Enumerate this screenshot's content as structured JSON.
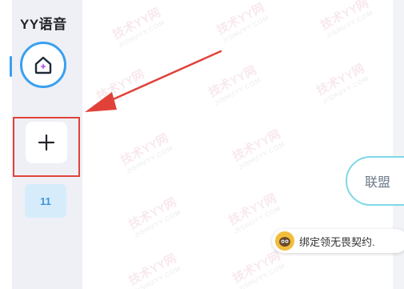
{
  "app": {
    "title": "YY语音"
  },
  "sidebar": {
    "home_icon": "home-sparkle-icon",
    "add_icon": "plus-icon",
    "count_badge": "11"
  },
  "channel": {
    "alliance_label": "联盟"
  },
  "notice": {
    "text": "绑定领无畏契约.",
    "icon": "mascot-avatar-icon"
  },
  "annotation": {
    "highlight_color": "#e0423a",
    "arrow_color": "#e0423a"
  },
  "watermark": {
    "text": "技术YY网",
    "subtext": "JISHUYY.COM"
  },
  "colors": {
    "accent": "#3aa0f0",
    "badge_bg": "#d6ecfb",
    "badge_text": "#3d95dd"
  }
}
